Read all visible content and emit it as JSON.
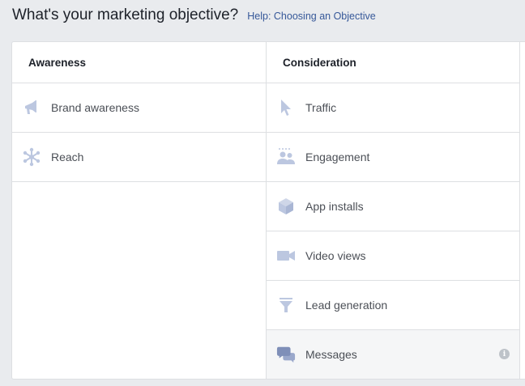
{
  "header": {
    "title": "What's your marketing objective?",
    "help_link": "Help: Choosing an Objective"
  },
  "columns": [
    {
      "heading": "Awareness",
      "items": [
        {
          "label": "Brand awareness",
          "icon": "megaphone-icon"
        },
        {
          "label": "Reach",
          "icon": "reach-icon"
        }
      ]
    },
    {
      "heading": "Consideration",
      "items": [
        {
          "label": "Traffic",
          "icon": "cursor-icon"
        },
        {
          "label": "Engagement",
          "icon": "people-icon"
        },
        {
          "label": "App installs",
          "icon": "cube-icon"
        },
        {
          "label": "Video views",
          "icon": "video-camera-icon"
        },
        {
          "label": "Lead generation",
          "icon": "funnel-icon"
        },
        {
          "label": "Messages",
          "icon": "chat-bubbles-icon",
          "selected": true,
          "info_glyph": "i"
        }
      ]
    }
  ],
  "colors": {
    "icon": "#bcc7e0",
    "icon_active": "#7f8fb8",
    "link": "#365899",
    "background": "#e9ebee",
    "border": "#dddfe2"
  }
}
